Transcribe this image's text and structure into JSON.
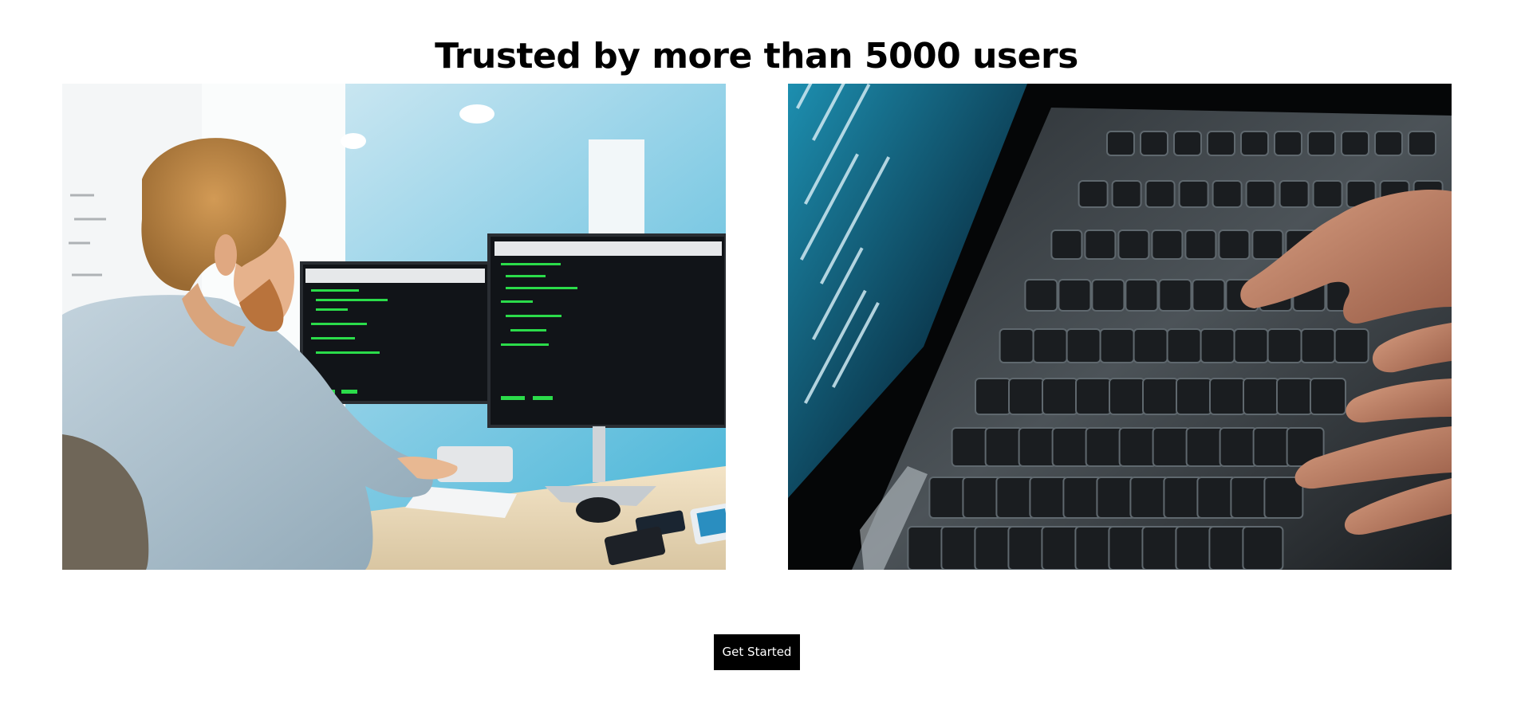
{
  "section": {
    "heading": "Trusted by more than 5000 users"
  },
  "gallery": {
    "images": [
      {
        "subject": "developer-at-dual-monitors"
      },
      {
        "subject": "hands-typing-on-laptop-keyboard"
      }
    ]
  },
  "cta": {
    "label": "Get Started"
  },
  "colors": {
    "background": "#ffffff",
    "text": "#000000",
    "button_bg": "#000000",
    "button_text": "#ffffff",
    "terminal_green": "#2bdc4a",
    "screen_cyan": "#1d8fb0"
  }
}
